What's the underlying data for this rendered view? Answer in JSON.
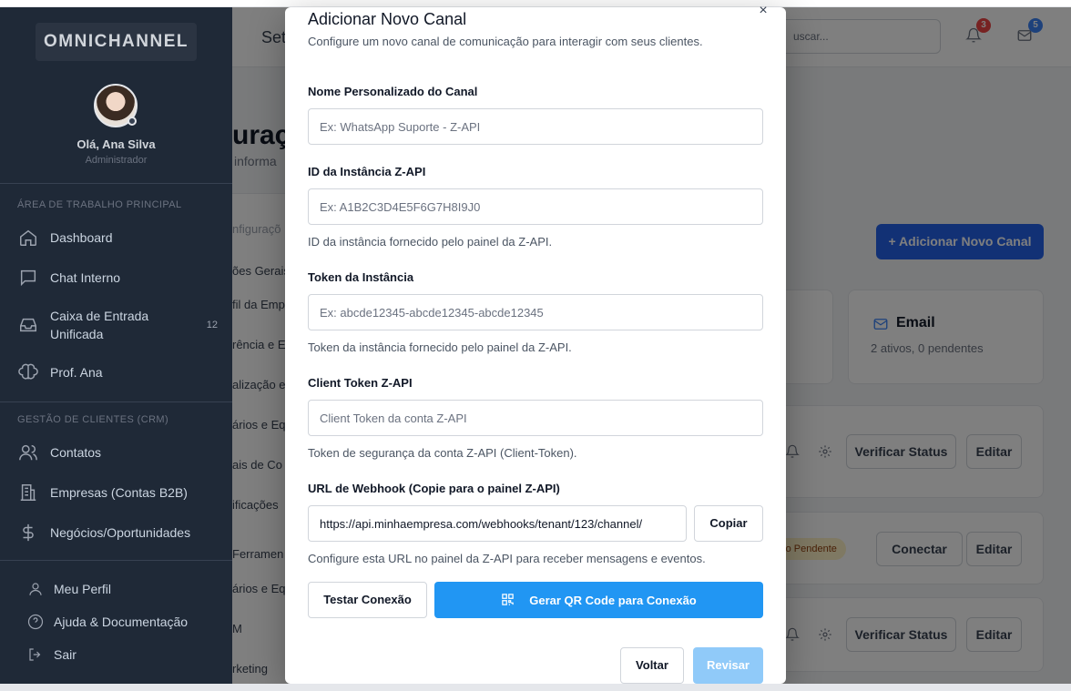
{
  "sidebar": {
    "logo": "OMNICHANNEL",
    "user_name": "Olá, Ana Silva",
    "user_role": "Administrador",
    "section_main": "ÁREA DE TRABALHO PRINCIPAL",
    "section_crm": "GESTÃO DE CLIENTES (CRM)",
    "items": [
      {
        "label": "Dashboard",
        "icon": "home-icon"
      },
      {
        "label": "Chat Interno",
        "icon": "chat-icon"
      },
      {
        "label": "Caixa de Entrada Unificada",
        "icon": "inbox-icon",
        "count": "12"
      },
      {
        "label": "Prof. Ana",
        "icon": "brain-icon"
      },
      {
        "label": "Contatos",
        "icon": "users-icon"
      },
      {
        "label": "Empresas (Contas B2B)",
        "icon": "building-icon"
      },
      {
        "label": "Negócios/Oportunidades",
        "icon": "dollar-icon"
      }
    ],
    "footer": [
      {
        "label": "Meu Perfil",
        "icon": "user-icon"
      },
      {
        "label": "Ajuda & Documentação",
        "icon": "help-icon"
      },
      {
        "label": "Sair",
        "icon": "logout-icon"
      }
    ]
  },
  "header": {
    "title": "Set",
    "search_placeholder": "uscar...",
    "notifications_count": "3",
    "messages_count": "5"
  },
  "page": {
    "title": "uraç",
    "subtitle": "informa",
    "tabs": [
      "nfiguraçõ",
      "ões Gerais",
      "fil da Emp",
      "rência e E",
      "alização e",
      "ários e Eq",
      "ais de Co",
      "ificações",
      "Ferramen",
      "ários e Eq",
      "M",
      "rketing"
    ],
    "add_button": "+ Adicionar Novo Canal",
    "email_card": {
      "title": "Email",
      "subtitle": "2 ativos, 0 pendentes"
    },
    "card_fragment": "t",
    "verify_status": "Verificar Status",
    "edit": "Editar",
    "connect": "Conectar",
    "pending": "ção Pendente"
  },
  "modal": {
    "title": "Adicionar Novo Canal",
    "subtitle": "Configure um novo canal de comunicação para interagir com seus clientes.",
    "close": "×",
    "fields": {
      "name": {
        "label": "Nome Personalizado do Canal",
        "placeholder": "Ex: WhatsApp Suporte - Z-API"
      },
      "instance_id": {
        "label": "ID da Instância Z-API",
        "placeholder": "Ex: A1B2C3D4E5F6G7H8I9J0",
        "help": "ID da instância fornecido pelo painel da Z-API."
      },
      "token": {
        "label": "Token da Instância",
        "placeholder": "Ex: abcde12345-abcde12345-abcde12345",
        "help": "Token da instância fornecido pelo painel da Z-API."
      },
      "client_token": {
        "label": "Client Token Z-API",
        "placeholder": "Client Token da conta Z-API",
        "help": "Token de segurança da conta Z-API (Client-Token)."
      },
      "webhook": {
        "label": "URL de Webhook (Copie para o painel Z-API)",
        "value": "https://api.minhaempresa.com/webhooks/tenant/123/channel/",
        "help": "Configure esta URL no painel da Z-API para receber mensagens e eventos."
      }
    },
    "copy_button": "Copiar",
    "test_button": "Testar Conexão",
    "qr_button": "Gerar QR Code para Conexão",
    "back_button": "Voltar",
    "review_button": "Revisar"
  },
  "colors": {
    "sidebar_bg": "#1f2937",
    "primary": "#2196f3",
    "primary_disabled": "#90caf9",
    "notification_badge": "#ef4444",
    "message_badge": "#3b82f6"
  }
}
